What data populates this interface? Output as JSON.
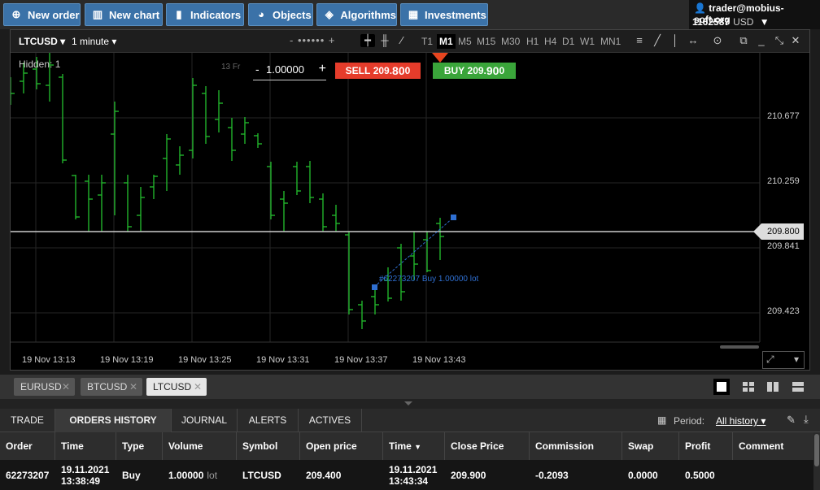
{
  "toolbar": {
    "new_order": "New order",
    "new_chart": "New chart",
    "indicators": "Indicators",
    "objects": "Objects",
    "algorithms": "Algorithms",
    "investments": "Investments"
  },
  "account": {
    "user": "trader@mobius-soft.org",
    "balance": "1162587",
    "currency": "USD"
  },
  "chart": {
    "symbol": "LTCUSD",
    "timeframe": "1 minute",
    "zoom": "- •••••• +",
    "periods": [
      "T1",
      "M1",
      "M5",
      "M15",
      "M30",
      "H1",
      "H4",
      "D1",
      "W1",
      "MN1"
    ],
    "active_period": "M1",
    "hidden": "Hidden: 1",
    "fr_label": "13 Fr",
    "volume_minus": "-",
    "volume": "1.00000",
    "volume_plus": "+",
    "sell_label": "SELL",
    "sell_price_a": "209.",
    "sell_price_b": "80",
    "sell_price_c": "0",
    "buy_label": "BUY",
    "buy_price_a": "209.",
    "buy_price_b": "90",
    "buy_price_c": "0",
    "price_levels": [
      "210.677",
      "210.259",
      "209.841",
      "209.423"
    ],
    "current_price": "209.800",
    "time_labels": [
      "19 Nov 13:13",
      "19 Nov 13:19",
      "19 Nov 13:25",
      "19 Nov 13:31",
      "19 Nov 13:37",
      "19 Nov 13:43"
    ],
    "order_annotation": "#62273207 Buy 1.00000 lot",
    "colors": {
      "bar": "#21b32b",
      "grid": "#262626",
      "sell": "#e53c2b",
      "buy": "#3aa53a",
      "order_line": "#2f6fd1"
    }
  },
  "symbol_tabs": [
    "EURUSD",
    "BTCUSD",
    "LTCUSD"
  ],
  "active_symbol_tab": "LTCUSD",
  "bottom_tabs": [
    "TRADE",
    "ORDERS HISTORY",
    "JOURNAL",
    "ALERTS",
    "ACTIVES"
  ],
  "active_bottom_tab": "ORDERS HISTORY",
  "period_filter": {
    "label": "Period:",
    "value": "All history"
  },
  "table": {
    "columns": [
      "Order",
      "Time",
      "Type",
      "Volume",
      "Symbol",
      "Open price",
      "Time",
      "Close Price",
      "Commission",
      "Swap",
      "Profit",
      "Comment"
    ],
    "rows": [
      {
        "order": "62273207",
        "time_date": "19.11.2021",
        "time_clock": "13:38:49",
        "type": "Buy",
        "volume": "1.00000",
        "volume_unit": "lot",
        "symbol": "LTCUSD",
        "open_price": "209.400",
        "close_date": "19.11.2021",
        "close_clock": "13:43:34",
        "close_price": "209.900",
        "commission": "-0.2093",
        "swap": "0.0000",
        "profit": "0.5000",
        "comment": ""
      }
    ]
  }
}
